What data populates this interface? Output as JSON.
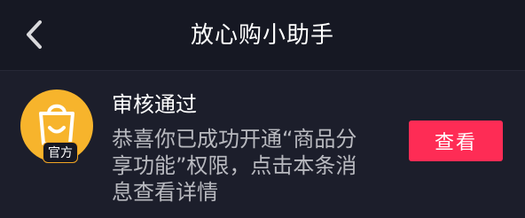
{
  "header": {
    "title": "放心购小助手",
    "back_icon": "chevron-left-icon"
  },
  "message": {
    "avatar_icon": "shopping-bag-smile-icon",
    "badge": "官方",
    "title": "审核通过",
    "body": "恭喜你已成功开通“商品分享功能”权限，点击本条消息查看详情",
    "action_label": "查看"
  },
  "colors": {
    "background": "#161823",
    "card": "#1c1e2b",
    "accent": "#fe2c55",
    "avatar": "#f7b42c"
  }
}
